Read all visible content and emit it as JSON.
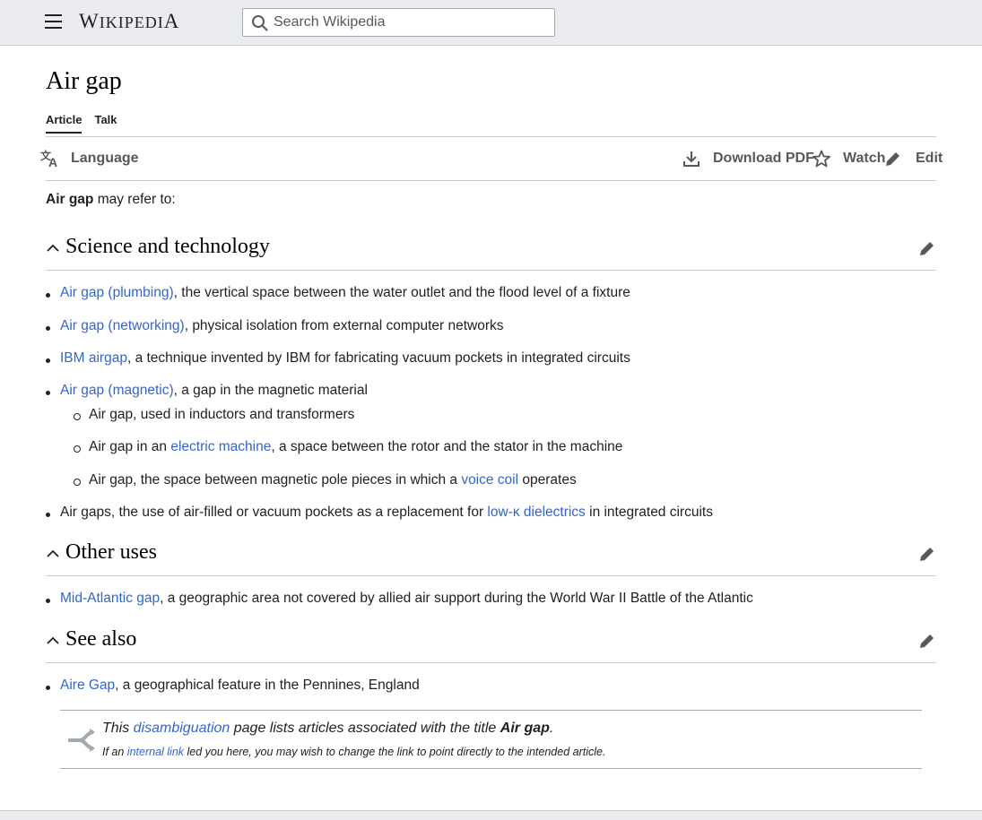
{
  "header": {
    "wordmark_first": "W",
    "wordmark_rest": "IKIPEDI",
    "wordmark_last": "A",
    "search_placeholder": "Search Wikipedia"
  },
  "page": {
    "title": "Air gap",
    "tabs": [
      "Article",
      "Talk"
    ],
    "toolbar": {
      "language": "Language",
      "download": "Download PDF",
      "watch": "Watch",
      "edit": "Edit"
    }
  },
  "intro": {
    "bold": "Air gap",
    "rest": " may refer to:"
  },
  "sections": [
    {
      "heading": "Science and technology",
      "items": [
        {
          "link": "Air gap (plumbing)",
          "text": ", the vertical space between the water outlet and the flood level of a fixture"
        },
        {
          "link": "Air gap (networking)",
          "text": ", physical isolation from external computer networks"
        },
        {
          "link": "IBM airgap",
          "text": ", a technique invented by IBM for fabricating vacuum pockets in integrated circuits"
        },
        {
          "link": "Air gap (magnetic)",
          "text": ", a gap in the magnetic material",
          "subitems": [
            {
              "pre": "Air gap, used in inductors and transformers"
            },
            {
              "pre": "Air gap in an ",
              "link": "electric machine",
              "post": ", a space between the rotor and the stator in the machine"
            },
            {
              "pre": "Air gap, the space between magnetic pole pieces in which a ",
              "link": "voice coil",
              "post": " operates"
            }
          ]
        },
        {
          "pre": "Air gaps, the use of air-filled or vacuum pockets as a replacement for ",
          "link": "low-κ dielectrics",
          "post": " in integrated circuits"
        }
      ]
    },
    {
      "heading": "Other uses",
      "items": [
        {
          "link": "Mid-Atlantic gap",
          "text": ", a geographic area not covered by allied air support during the World War II Battle of the Atlantic"
        }
      ]
    },
    {
      "heading": "See also",
      "items": [
        {
          "link": "Aire Gap",
          "text": ", a geographical feature in the Pennines, England"
        }
      ]
    }
  ],
  "disambig": {
    "l1_pre": "This ",
    "l1_link": "disambiguation",
    "l1_mid": " page lists articles associated with the title ",
    "l1_bold": "Air gap",
    "l1_post": ".",
    "l2_pre": "If an ",
    "l2_link": "internal link",
    "l2_post": " led you here, you may wish to change the link to point directly to the intended article."
  },
  "colors": {
    "link": "#3366cc",
    "chrome": "#eaecf0",
    "text": "#202122"
  }
}
